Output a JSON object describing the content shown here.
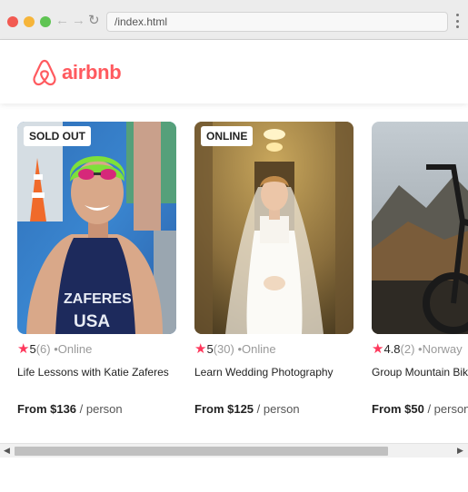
{
  "browser": {
    "url": "/index.html",
    "back_icon": "arrow-left-icon",
    "forward_icon": "arrow-right-icon",
    "reload_icon": "reload-icon",
    "menu_icon": "kebab-menu-icon"
  },
  "brand": {
    "name": "airbnb",
    "color": "#ff5a5f"
  },
  "cards": [
    {
      "badge": "SOLD OUT",
      "rating": "5",
      "reviews": "(6)",
      "location": "•Online",
      "title": "Life Lessons with Katie Zaferes",
      "price": "From $136",
      "unit": "/ person",
      "image": "athlete-photo"
    },
    {
      "badge": "ONLINE",
      "rating": "5",
      "reviews": "(30)",
      "location": "•Online",
      "title": "Learn Wedding Photography",
      "price": "From $125",
      "unit": "/ person",
      "image": "bride-photo"
    },
    {
      "badge": "",
      "rating": "4.8",
      "reviews": "(2)",
      "location": "•Norway",
      "title": "Group Mountain Biking",
      "price": "From $50",
      "unit": "/ person",
      "image": "mountain-bike-photo"
    }
  ],
  "star_color": "#fe385c"
}
